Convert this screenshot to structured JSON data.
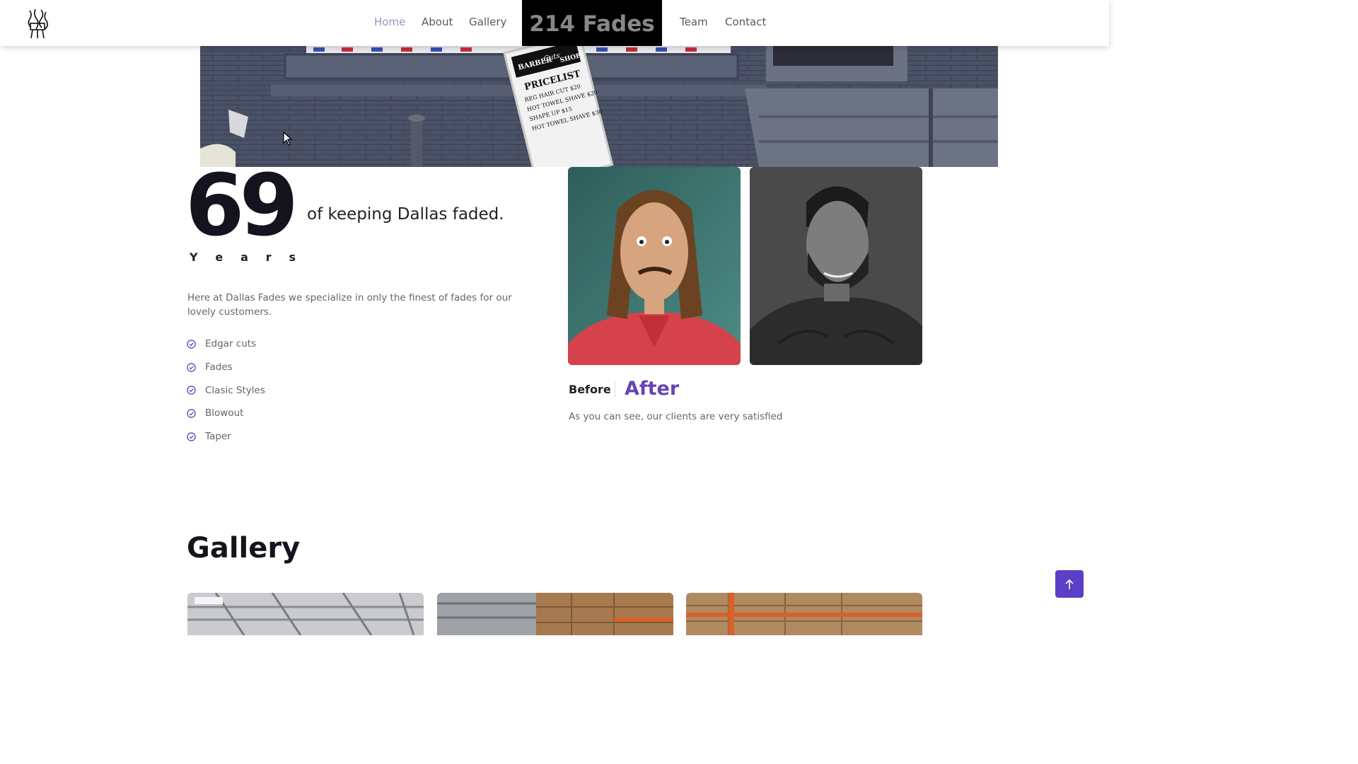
{
  "nav": {
    "logo_icon": "barbershop-logo-icon",
    "links": [
      {
        "label": "Home",
        "active": true
      },
      {
        "label": "About",
        "active": false
      },
      {
        "label": "Gallery",
        "active": false
      },
      {
        "label": "Team",
        "active": false
      },
      {
        "label": "Contact",
        "active": false
      }
    ],
    "brand": "214 Fades"
  },
  "hero": {
    "sign_top": "BARBER",
    "sign_script": "Cuts",
    "sign_shop": "SHOP",
    "sign_title": "PRICELIST",
    "sign_lines": [
      "REG HAIR CUT $20",
      "HOT TOWEL SHAVE $20",
      "SHAPE UP $15",
      "HOT TOWEL SHAVE $30"
    ]
  },
  "about": {
    "years_number": "69",
    "years_letters": [
      "Y",
      "e",
      "a",
      "r",
      "s"
    ],
    "tagline": "of keeping Dallas faded.",
    "intro": "Here at Dallas Fades we specialize in only the finest of fades for our lovely customers.",
    "services": [
      "Edgar cuts",
      "Fades",
      "Clasic Styles",
      "Blowout",
      "Taper"
    ],
    "check_icon": "check-circle-icon"
  },
  "before_after": {
    "before_label": "Before",
    "after_label": "After",
    "caption": "As you can see, our clients are very satisfied"
  },
  "gallery": {
    "title": "Gallery"
  },
  "colors": {
    "accent": "#6643b5",
    "nav_active": "#9b90c2",
    "brand_bg": "#000000",
    "to_top_bg": "#5b3fc6"
  },
  "to_top_icon": "arrow-up-icon"
}
